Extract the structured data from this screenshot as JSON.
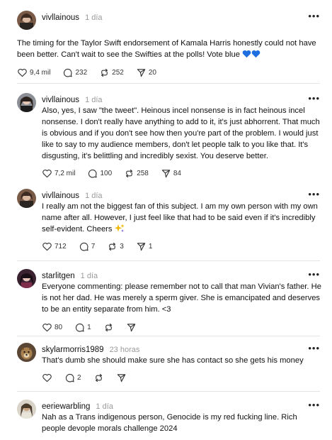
{
  "posts": [
    {
      "username": "vivllainous",
      "time": "1 día",
      "text": "The timing for the Taylor Swift endorsement of Kamala Harris honestly could not have been better. Can't wait to see the Swifties at the polls! Vote blue",
      "likes": "9,4 mil",
      "replies": "232",
      "reposts": "252",
      "shares": "20"
    },
    {
      "username": "vivllainous",
      "time": "1 día",
      "text": "Also, yes, I saw \"the tweet\". Heinous incel nonsense is in fact heinous incel nonsense. I don't really have anything to add to it, it's just abhorrent. That much is obvious and if you don't see how then you're part of the problem. I would just like to say to my audience members, don't let people talk to you like that. It's disgusting, it's belittling and incredibly sexist. You deserve better.",
      "likes": "7,2 mil",
      "replies": "100",
      "reposts": "258",
      "shares": "84"
    },
    {
      "username": "vivllainous",
      "time": "1 día",
      "text": "I really am not the biggest fan of this subject. I am my own person with my own name after all. However, I just feel like that had to be said even if it's incredibly self-evident. Cheers",
      "likes": "712",
      "replies": "7",
      "reposts": "3",
      "shares": "1"
    },
    {
      "username": "starlitgen",
      "time": "1 día",
      "text": "Everyone commenting: please remember not to call that man Vivian's father. He is not her dad. He was merely a sperm giver. She is emancipated and deserves to be an entity separate from him. <3",
      "likes": "80",
      "replies": "1",
      "reposts": "",
      "shares": ""
    },
    {
      "username": "skylarmorris1989",
      "time": "23 horas",
      "text": "That's dumb she should make sure she has contact so she gets his money",
      "likes": "",
      "replies": "2",
      "reposts": "",
      "shares": ""
    },
    {
      "username": "eeriewarbling",
      "time": "1 día",
      "text": "Nah as a Trans indigenous person, Genocide is my red fucking line. Rich people devople morals challenge 2024",
      "likes": "",
      "replies": "",
      "reposts": "",
      "shares": ""
    }
  ],
  "icons": {
    "more": "more-options-icon",
    "like": "heart-icon",
    "reply": "comment-icon",
    "repost": "repost-icon",
    "share": "send-icon",
    "emoji_hearts": "blue-heart-emoji",
    "emoji_cheers": "sparkles-emoji"
  },
  "colors": {
    "emoji_blue": "#1f6fe0",
    "divider": "#e4e4e4",
    "muted_text": "#9a9a9a"
  }
}
